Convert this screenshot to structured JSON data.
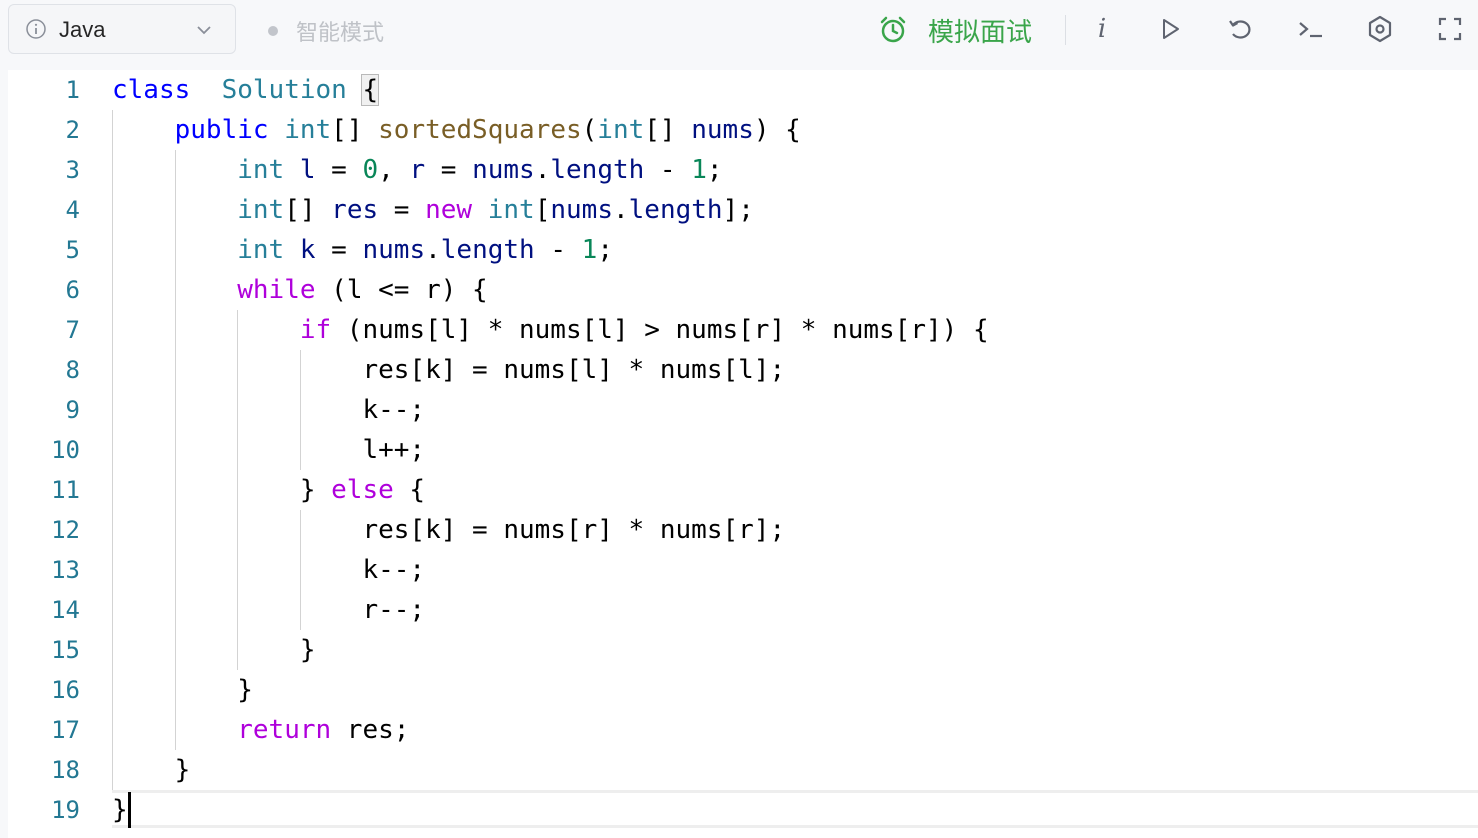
{
  "toolbar": {
    "language": "Java",
    "mode_label": "智能模式",
    "interview_label": "模拟面试",
    "info_label": "i",
    "colors": {
      "accent_green": "#3aa54a",
      "muted_gray": "#bfc2c7"
    },
    "icons": [
      "info-circle-icon",
      "chevron-down-icon",
      "alarm-clock-icon",
      "info-icon",
      "run-icon",
      "reset-icon",
      "console-icon",
      "settings-icon",
      "fullscreen-icon"
    ]
  },
  "editor": {
    "line_numbers": [
      "1",
      "2",
      "3",
      "4",
      "5",
      "6",
      "7",
      "8",
      "9",
      "10",
      "11",
      "12",
      "13",
      "14",
      "15",
      "16",
      "17",
      "18",
      "19"
    ],
    "code": [
      [
        [
          "k",
          "class"
        ],
        [
          "",
          "  "
        ],
        [
          "t",
          "Solution"
        ],
        [
          "",
          " "
        ],
        [
          "b",
          "{"
        ]
      ],
      [
        [
          "",
          "    "
        ],
        [
          "k",
          "public"
        ],
        [
          "",
          " "
        ],
        [
          "t",
          "int"
        ],
        [
          "",
          "[] "
        ],
        [
          "f",
          "sortedSquares"
        ],
        [
          "",
          "("
        ],
        [
          "t",
          "int"
        ],
        [
          "",
          "[] "
        ],
        [
          "v",
          "nums"
        ],
        [
          "",
          ") {"
        ]
      ],
      [
        [
          "",
          "        "
        ],
        [
          "t",
          "int"
        ],
        [
          "",
          " "
        ],
        [
          "v",
          "l"
        ],
        [
          "",
          " = "
        ],
        [
          "n",
          "0"
        ],
        [
          "",
          ", "
        ],
        [
          "v",
          "r"
        ],
        [
          "",
          " = "
        ],
        [
          "v",
          "nums"
        ],
        [
          "",
          "."
        ],
        [
          "v",
          "length"
        ],
        [
          "",
          " - "
        ],
        [
          "n",
          "1"
        ],
        [
          "",
          ";"
        ]
      ],
      [
        [
          "",
          "        "
        ],
        [
          "t",
          "int"
        ],
        [
          "",
          "[] "
        ],
        [
          "v",
          "res"
        ],
        [
          "",
          " = "
        ],
        [
          "c",
          "new"
        ],
        [
          "",
          " "
        ],
        [
          "t",
          "int"
        ],
        [
          "",
          "["
        ],
        [
          "v",
          "nums"
        ],
        [
          "",
          "."
        ],
        [
          "v",
          "length"
        ],
        [
          "",
          "];"
        ]
      ],
      [
        [
          "",
          "        "
        ],
        [
          "t",
          "int"
        ],
        [
          "",
          " "
        ],
        [
          "v",
          "k"
        ],
        [
          "",
          " = "
        ],
        [
          "v",
          "nums"
        ],
        [
          "",
          "."
        ],
        [
          "v",
          "length"
        ],
        [
          "",
          " - "
        ],
        [
          "n",
          "1"
        ],
        [
          "",
          ";"
        ]
      ],
      [
        [
          "",
          "        "
        ],
        [
          "c",
          "while"
        ],
        [
          "",
          " (l <= r) {"
        ]
      ],
      [
        [
          "",
          "            "
        ],
        [
          "c",
          "if"
        ],
        [
          "",
          " (nums[l] * nums[l] > nums[r] * nums[r]) {"
        ]
      ],
      [
        [
          "",
          "                res[k] = nums[l] * nums[l];"
        ]
      ],
      [
        [
          "",
          "                k--;"
        ]
      ],
      [
        [
          "",
          "                l++;"
        ]
      ],
      [
        [
          "",
          "            } "
        ],
        [
          "c",
          "else"
        ],
        [
          "",
          " {"
        ]
      ],
      [
        [
          "",
          "                res[k] = nums[r] * nums[r];"
        ]
      ],
      [
        [
          "",
          "                k--;"
        ]
      ],
      [
        [
          "",
          "                r--;"
        ]
      ],
      [
        [
          "",
          "            }"
        ]
      ],
      [
        [
          "",
          "        }"
        ]
      ],
      [
        [
          "",
          "        "
        ],
        [
          "c",
          "return"
        ],
        [
          "",
          " res;"
        ]
      ],
      [
        [
          "",
          "    }"
        ]
      ],
      [
        [
          "",
          "}"
        ]
      ]
    ]
  }
}
